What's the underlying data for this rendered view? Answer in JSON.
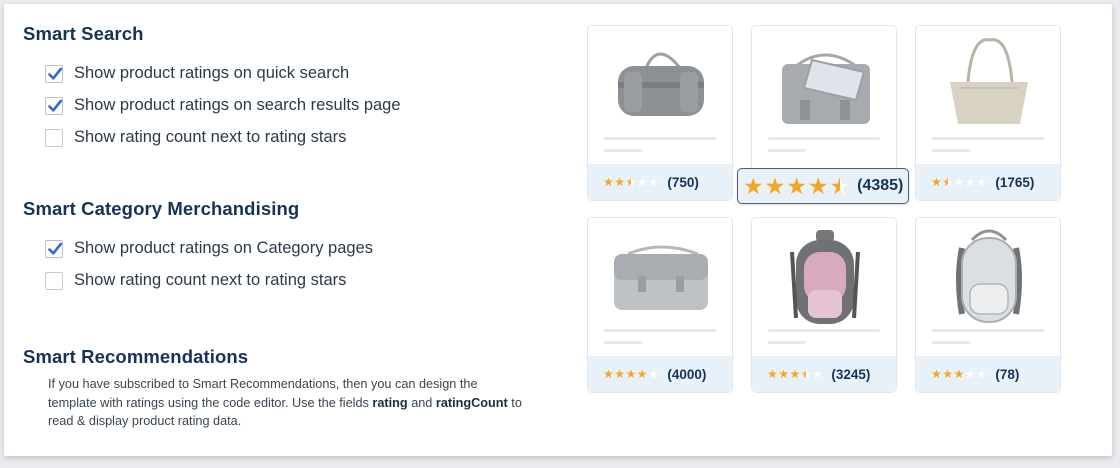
{
  "smart_search": {
    "title": "Smart Search",
    "options": [
      {
        "label": "Show product ratings on quick search",
        "checked": true
      },
      {
        "label": "Show product ratings on search results page",
        "checked": true
      },
      {
        "label": "Show rating count next to rating stars",
        "checked": false
      }
    ]
  },
  "category": {
    "title": "Smart Category Merchandising",
    "options": [
      {
        "label": "Show product ratings on Category pages",
        "checked": true
      },
      {
        "label": "Show rating count next to rating stars",
        "checked": false
      }
    ]
  },
  "recommendations": {
    "title": "Smart Recommendations",
    "desc_1": "If you have subscribed to Smart Recommendations, then you can design the template with ratings using the code editor. Use the fields ",
    "field_1": "rating",
    "desc_2": " and ",
    "field_2": "ratingCount",
    "desc_3": " to read & display product rating data."
  },
  "products": [
    {
      "image": "duffel-bag-icon",
      "rating": 2.5,
      "count": "(750)"
    },
    {
      "image": "messenger-bag-icon",
      "rating": 4.5,
      "count": "(4385)",
      "highlighted": true
    },
    {
      "image": "tote-bag-icon",
      "rating": 1.5,
      "count": "(1765)"
    },
    {
      "image": "shoulder-bag-icon",
      "rating": 4,
      "count": "(4000)"
    },
    {
      "image": "backpack-pink-icon",
      "rating": 3.5,
      "count": "(3245)"
    },
    {
      "image": "backpack-white-icon",
      "rating": 3,
      "count": "(78)"
    }
  ],
  "colors": {
    "star": "#f5a623",
    "title": "#17325a",
    "check": "#2f6bd3",
    "footer": "#e9f1f8"
  }
}
